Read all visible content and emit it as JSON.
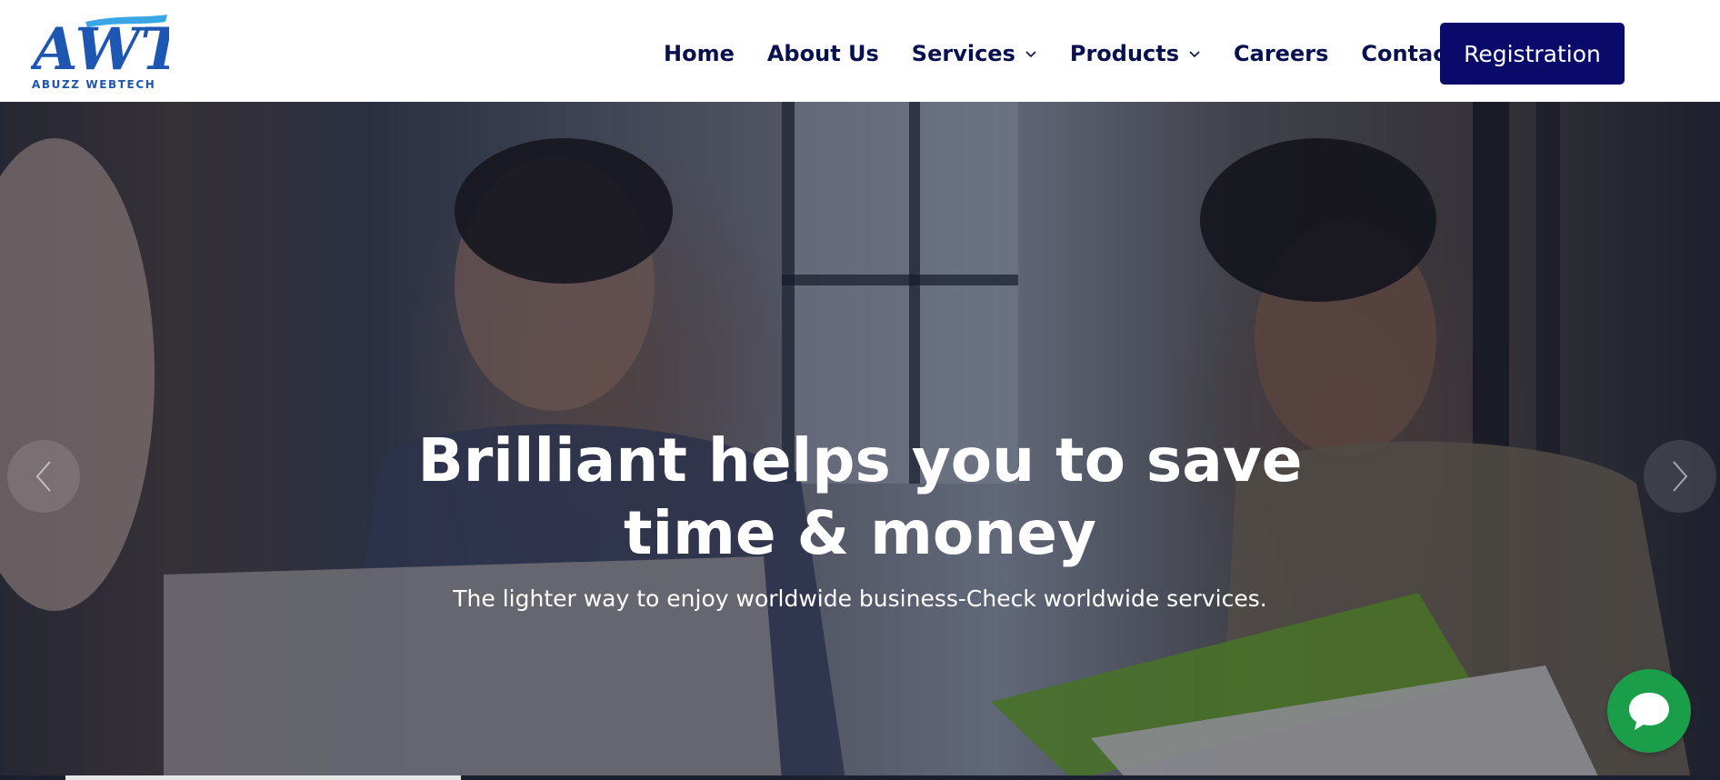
{
  "brand": {
    "logo_text": "AWT",
    "logo_subtitle": "ABUZZ WEBTECH",
    "logo_color": "#1e56b4"
  },
  "nav": {
    "items": [
      {
        "label": "Home",
        "has_dropdown": false
      },
      {
        "label": "About Us",
        "has_dropdown": false
      },
      {
        "label": "Services",
        "has_dropdown": true
      },
      {
        "label": "Products",
        "has_dropdown": true
      },
      {
        "label": "Careers",
        "has_dropdown": false
      },
      {
        "label": "Contact Us",
        "has_dropdown": false
      }
    ],
    "cta_label": "Registration",
    "cta_color": "#0a0a6a",
    "text_color": "#07114f"
  },
  "hero": {
    "headline_line1": "Brilliant helps you to save",
    "headline_line2": "time & money",
    "subheadline": "The lighter way to enjoy worldwide business-Check worldwide services.",
    "prev_icon": "chevron-left-icon",
    "next_icon": "chevron-right-icon",
    "slide_progress": 0.23
  },
  "chat": {
    "icon": "chat-bubble-icon",
    "color": "#1a9e4a"
  }
}
